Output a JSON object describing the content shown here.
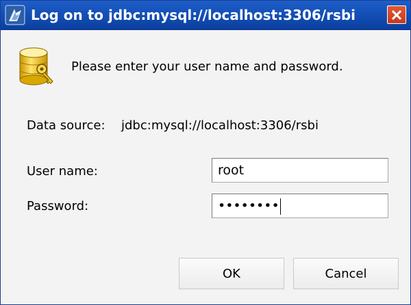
{
  "window": {
    "title": "Log on to jdbc:mysql://localhost:3306/rsbi",
    "icon": "app-icon",
    "close_icon": "close-icon"
  },
  "header": {
    "icon": "database-key-icon",
    "prompt": "Please enter your user name and password."
  },
  "data_source": {
    "label": "Data source:",
    "value": "jdbc:mysql://localhost:3306/rsbi"
  },
  "form": {
    "username_label": "User name:",
    "username_value": "root",
    "password_label": "Password:",
    "password_mask": "••••••••"
  },
  "buttons": {
    "ok_label": "OK",
    "cancel_label": "Cancel"
  },
  "colors": {
    "titlebar": "#1450b8",
    "close_button": "#c8391c",
    "dialog_background": "#f3f3f3"
  }
}
